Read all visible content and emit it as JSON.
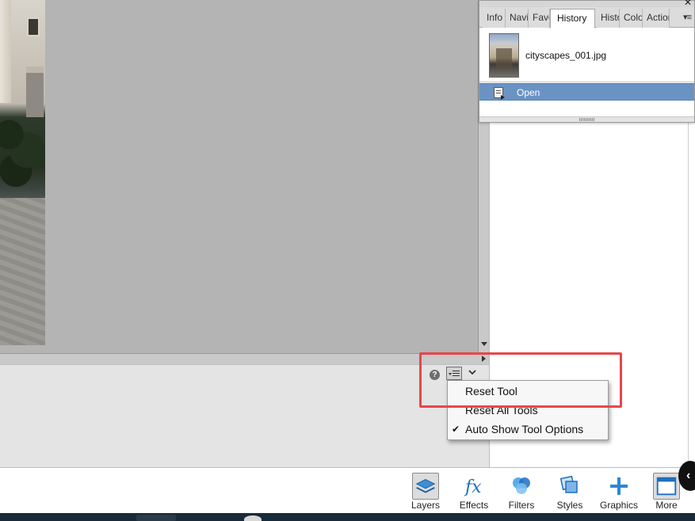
{
  "panel": {
    "tabs": [
      {
        "label": "Info"
      },
      {
        "label": "Navigator"
      },
      {
        "label": "Favorites"
      },
      {
        "label": "History"
      },
      {
        "label": "Histogram"
      },
      {
        "label": "Color"
      },
      {
        "label": "Actions"
      }
    ],
    "active_tab": "History",
    "snapshot_name": "cityscapes_001.jpg",
    "history_items": [
      {
        "label": "Open",
        "selected": true
      }
    ]
  },
  "tool_options": {
    "help_icon_text": "?",
    "menu": [
      {
        "label": "Reset Tool",
        "checked": false
      },
      {
        "label": "Reset All Tools",
        "checked": false
      },
      {
        "label": "Auto Show Tool Options",
        "checked": true
      }
    ],
    "check_mark": "✔"
  },
  "taskbar": {
    "buttons": [
      {
        "label": "Layers",
        "icon": "layers-icon"
      },
      {
        "label": "Effects",
        "icon": "fx-icon"
      },
      {
        "label": "Filters",
        "icon": "filters-icon"
      },
      {
        "label": "Styles",
        "icon": "styles-icon"
      },
      {
        "label": "Graphics",
        "icon": "plus-icon"
      },
      {
        "label": "More",
        "icon": "more-icon"
      }
    ]
  },
  "colors": {
    "selection": "#6a93c4",
    "highlight": "#e8464a",
    "accent": "#1e6fc0"
  }
}
